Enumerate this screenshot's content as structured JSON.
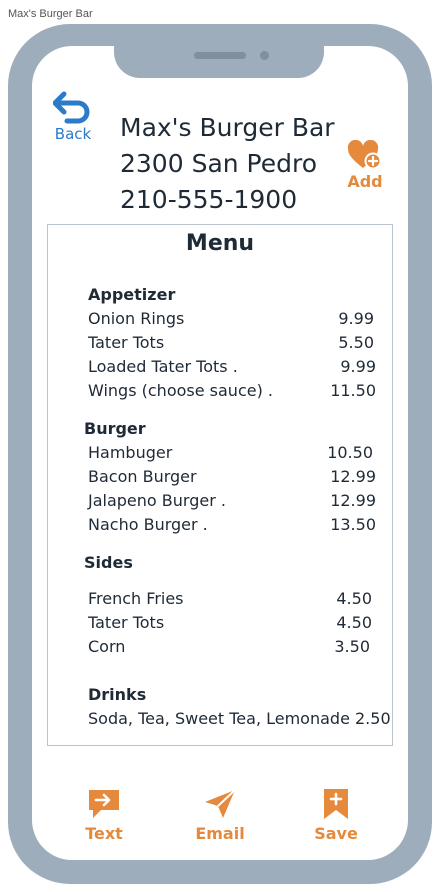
{
  "window": {
    "title": "Max's Burger Bar"
  },
  "colors": {
    "accent_orange": "#e58a3c",
    "accent_blue": "#2b7bc8",
    "frame_gray": "#9dadbb",
    "text_dark": "#1f2a37"
  },
  "header": {
    "back_label": "Back",
    "back_icon": "undo-arrow-icon",
    "name": "Max's Burger Bar",
    "address": "2300 San Pedro",
    "phone": "210-555-1900",
    "add_label": "Add",
    "add_icon": "heart-plus-icon"
  },
  "menu": {
    "title": "Menu",
    "sections": [
      {
        "name": "Appetizer",
        "items": [
          {
            "name": "Onion Rings",
            "price": "9.99"
          },
          {
            "name": "Tater Tots",
            "price": "5.50"
          },
          {
            "name": "Loaded Tater Tots .",
            "price": "9.99"
          },
          {
            "name": "Wings (choose sauce) .",
            "price": "11.50"
          }
        ]
      },
      {
        "name": "Burger",
        "items": [
          {
            "name": "Hambuger",
            "price": "10.50"
          },
          {
            "name": "Bacon Burger",
            "price": "12.99"
          },
          {
            "name": "Jalapeno Burger .",
            "price": "12.99"
          },
          {
            "name": "Nacho Burger .",
            "price": "13.50"
          }
        ]
      },
      {
        "name": "Sides",
        "items": [
          {
            "name": "French Fries",
            "price": "4.50"
          },
          {
            "name": "Tater Tots",
            "price": "4.50"
          },
          {
            "name": "Corn",
            "price": "3.50"
          }
        ]
      },
      {
        "name": "Drinks",
        "items": [
          {
            "name": "Soda, Tea, Sweet Tea, Lemonade 2.50",
            "price": ""
          }
        ]
      }
    ]
  },
  "actions": [
    {
      "label": "Text",
      "icon": "message-icon"
    },
    {
      "label": "Email",
      "icon": "send-icon"
    },
    {
      "label": "Save",
      "icon": "bookmark-plus-icon"
    }
  ]
}
